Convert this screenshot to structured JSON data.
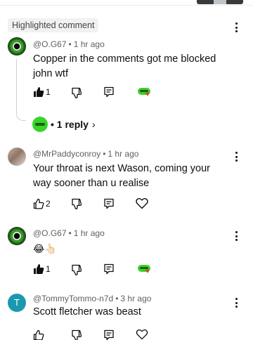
{
  "badge": "Highlighted comment",
  "reply_link": {
    "dot": "•",
    "label": "1 reply",
    "chevron": "›"
  },
  "comments": [
    {
      "author": "@O.G67",
      "time": "1 hr ago",
      "text": "Copper in the comments got me blocked john wtf",
      "likes": "1",
      "liked": true,
      "creator_heart": true
    },
    {
      "author": "@MrPaddyconroy",
      "time": "1 hr ago",
      "text": "Your throat is next Wason, coming your way sooner than u realise",
      "likes": "2",
      "liked": false,
      "creator_heart": false
    },
    {
      "author": "@O.G67",
      "time": "1 hr ago",
      "text": "😂👆🏻",
      "likes": "1",
      "liked": true,
      "creator_heart": true
    },
    {
      "author": "@TommyTommo-n7d",
      "time": "3 hr ago",
      "text": "Scott fletcher was beast",
      "likes": "",
      "liked": false,
      "creator_heart": false,
      "avatar_letter": "T"
    }
  ],
  "separator": "•",
  "icons": {
    "like": "thumbs-up-icon",
    "dislike": "thumbs-down-icon",
    "reply": "reply-icon",
    "heart": "heart-outline-icon",
    "creator_heart": "creator-heart-icon",
    "more": "more-vert-icon"
  },
  "colors": {
    "accent_green": "#39d429",
    "heart_red": "#e53935",
    "text": "#0f0f0f",
    "meta": "#606060",
    "avatar_t": "#1b98b0"
  }
}
